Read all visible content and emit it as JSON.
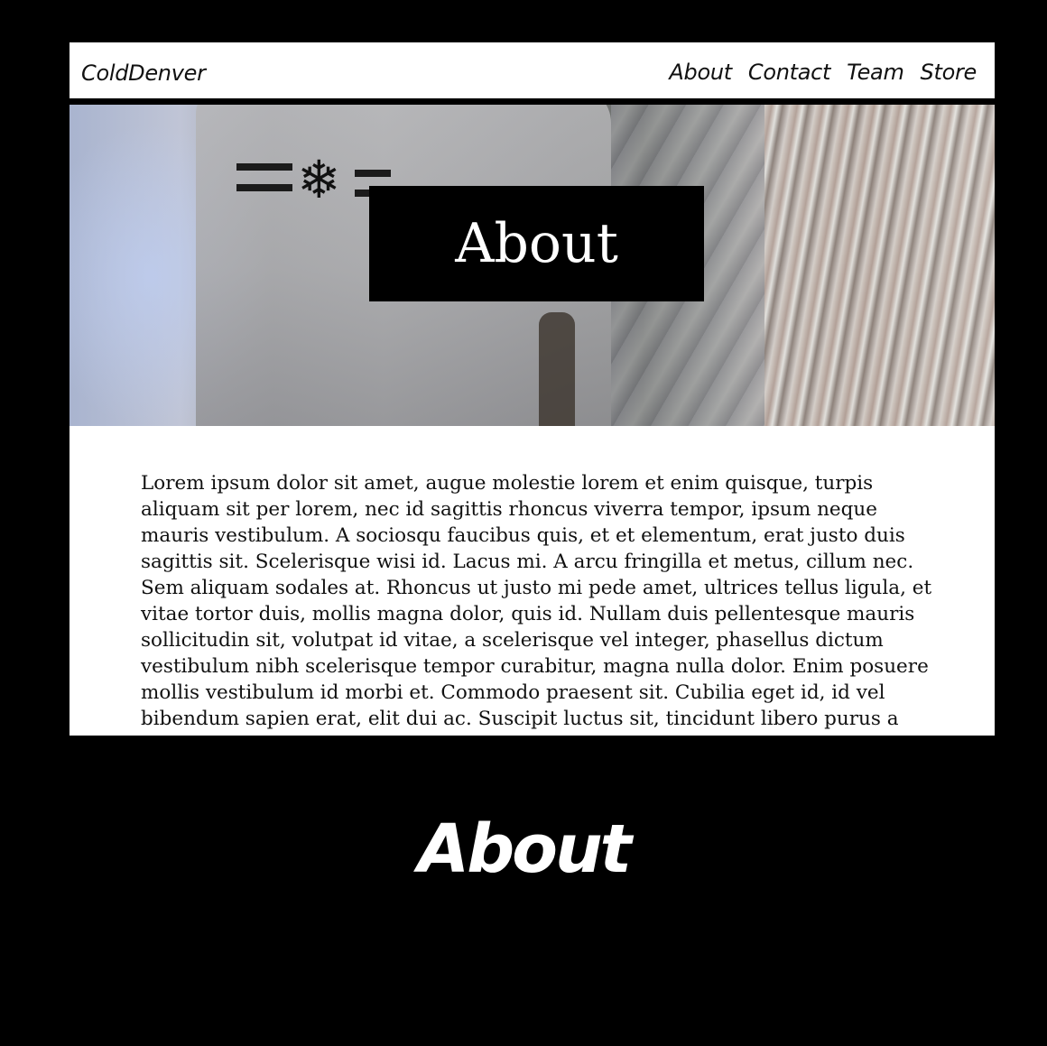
{
  "navbar": {
    "brand": "ColdDenver",
    "links": [
      {
        "label": "About"
      },
      {
        "label": "Contact"
      },
      {
        "label": "Team"
      },
      {
        "label": "Store"
      }
    ]
  },
  "hero": {
    "title": "About",
    "emblem": "snowflake-icon"
  },
  "content": {
    "body": "Lorem ipsum dolor sit amet, augue molestie lorem et enim quisque, turpis aliquam sit per lorem, nec id sagittis rhoncus viverra tempor, ipsum neque mauris vestibulum. A sociosqu faucibus quis, et et elementum, erat justo duis sagittis sit. Scelerisque wisi id. Lacus mi. A arcu fringilla et metus, cillum nec. Sem aliquam sodales at. Rhoncus ut justo mi pede amet, ultrices tellus ligula, et vitae tortor duis, mollis magna dolor, quis id. Nullam duis pellentesque mauris sollicitudin sit, volutpat id vitae, a scelerisque vel integer, phasellus dictum vestibulum nibh scelerisque tempor curabitur, magna nulla dolor. Enim posuere mollis vestibulum id morbi et. Commodo praesent sit. Cubilia eget id, id vel bibendum sapien erat, elit dui ac. Suscipit luctus sit, tincidunt libero purus a eleifend, amet ipsum blandit porttitor class,"
  },
  "caption": "About",
  "colors": {
    "page_background": "#000000",
    "panel_background": "#ffffff",
    "title_box": "#000000"
  }
}
